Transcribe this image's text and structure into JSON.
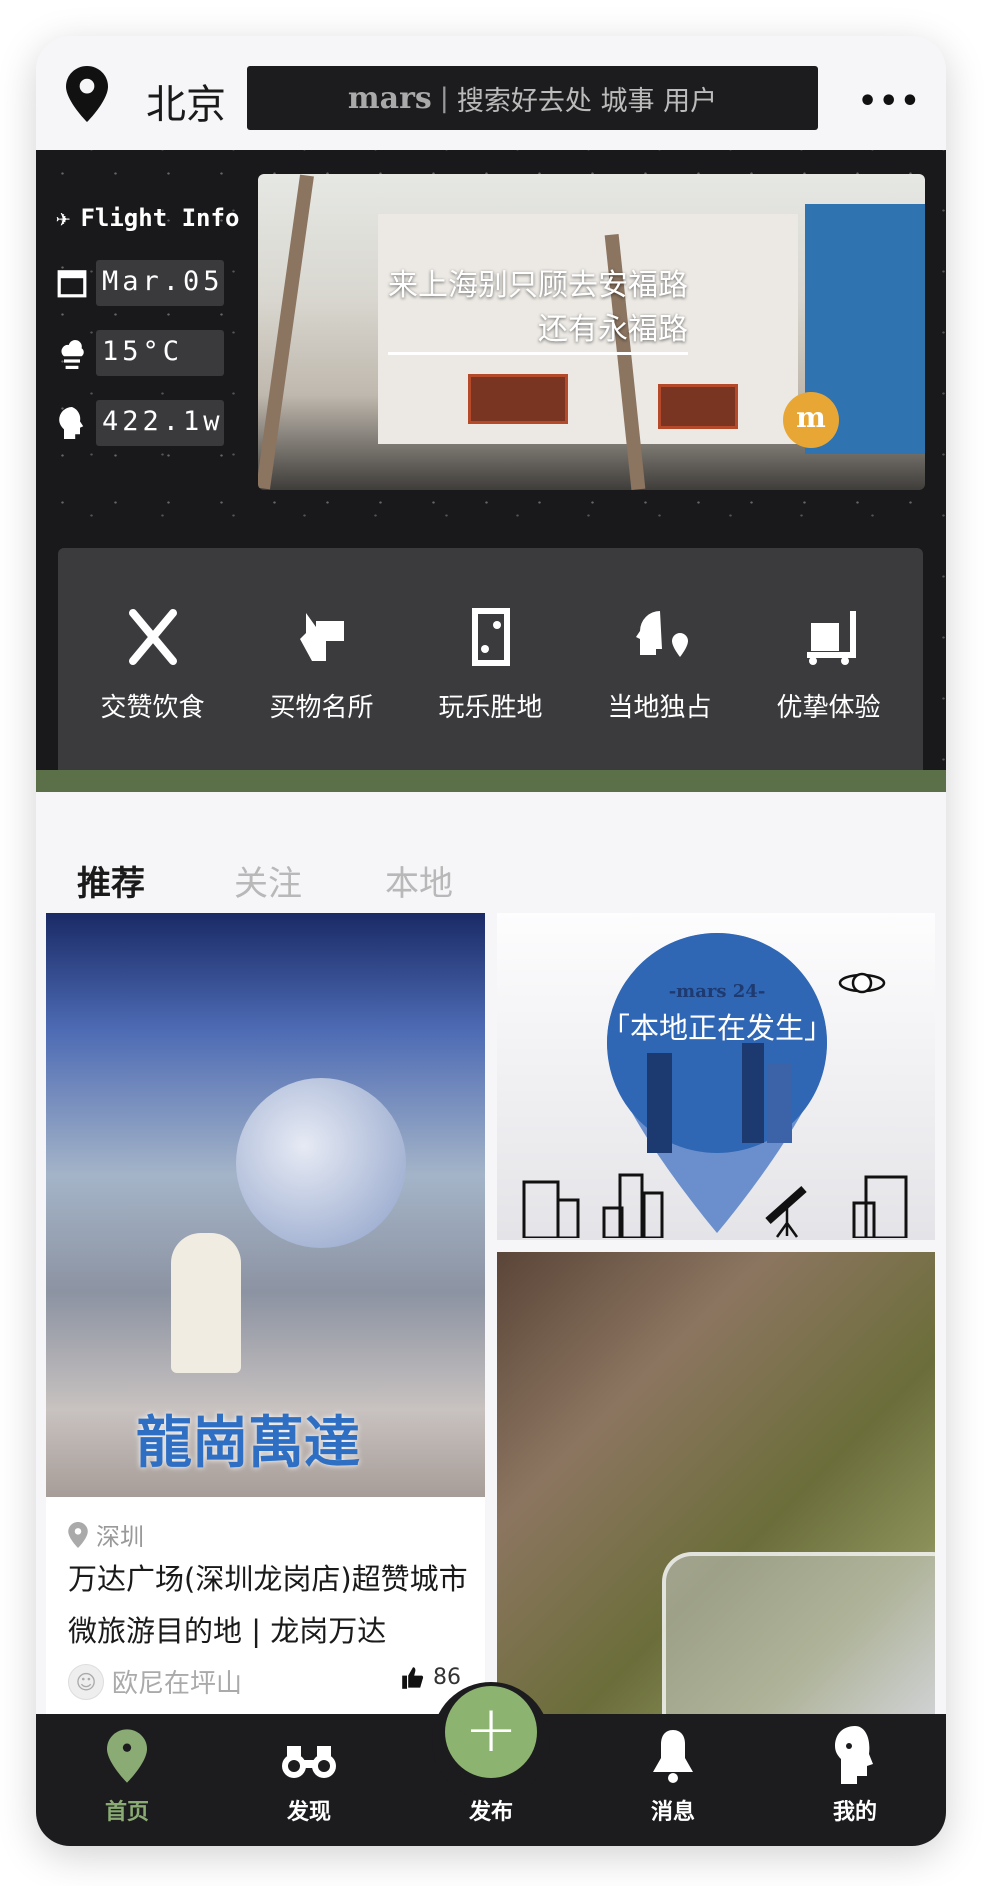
{
  "header": {
    "city": "北京",
    "search_brand": "mars",
    "search_placeholder": "搜索好去处 城事 用户",
    "more": "•••"
  },
  "info": {
    "flight_label": "Flight Info",
    "date": "Mar.05",
    "temperature": "15°C",
    "visitors": "422.1w"
  },
  "banner": {
    "caption_line1": "来上海别只顾去安福路",
    "caption_line2": "还有永福路",
    "logo": "m"
  },
  "categories": [
    {
      "label": "交赞饮食",
      "icon": "fork-knife-icon"
    },
    {
      "label": "买物名所",
      "icon": "hand-card-icon"
    },
    {
      "label": "玩乐胜地",
      "icon": "ticket-icon"
    },
    {
      "label": "当地独占",
      "icon": "head-pin-icon"
    },
    {
      "label": "优挚体验",
      "icon": "luggage-cart-icon"
    }
  ],
  "tabs": [
    {
      "label": "推荐",
      "active": true
    },
    {
      "label": "关注"
    },
    {
      "label": "本地"
    }
  ],
  "feed": {
    "left_card": {
      "image_title": "龍崗萬達",
      "location": "深圳",
      "title": "万达广场(深圳龙岗店)超赞城市微旅游目的地 | 龙岗万达",
      "author": "欧尼在坪山",
      "likes": "86"
    },
    "right_card_1": {
      "brand": "-mars 24-",
      "headline": "「本地正在发生」"
    }
  },
  "nav": {
    "items": [
      {
        "label": "首页",
        "active": true
      },
      {
        "label": "发现"
      },
      {
        "label": "发布"
      },
      {
        "label": "消息"
      },
      {
        "label": "我的"
      }
    ],
    "fab": "+"
  },
  "colors": {
    "accent": "#8cb36f",
    "dark": "#1c1b1e",
    "strip": "#5b7049"
  }
}
